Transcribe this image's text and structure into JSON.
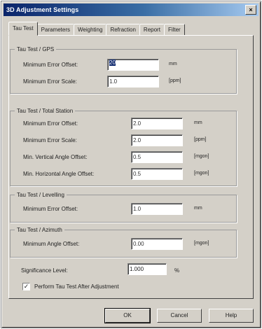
{
  "window": {
    "title": "3D Adjustment Settings",
    "close_glyph": "×"
  },
  "tabs": [
    {
      "label": "Tau Test",
      "active": true
    },
    {
      "label": "Parameters"
    },
    {
      "label": "Weighting"
    },
    {
      "label": "Refraction"
    },
    {
      "label": "Report"
    },
    {
      "label": "Filter"
    }
  ],
  "gps": {
    "title": "Tau Test / GPS",
    "min_error_offset": {
      "label": "Minimum Error Offset:",
      "value": "20",
      "unit": "mm"
    },
    "min_error_scale": {
      "label": "Minimum Error Scale:",
      "value": "1.0",
      "unit": "[ppm]"
    }
  },
  "total_station": {
    "title": "Tau Test / Total Station",
    "min_error_offset": {
      "label": "Minimum Error Offset:",
      "value": "2.0",
      "unit": "mm"
    },
    "min_error_scale": {
      "label": "Minimum Error Scale:",
      "value": "2.0",
      "unit": "[ppm]"
    },
    "min_vertical_angle_offset": {
      "label": "Min. Vertical Angle Offset:",
      "value": "0.5",
      "unit": "[mgon]"
    },
    "min_horizontal_angle_offset": {
      "label": "Min. Horizontal Angle Offset:",
      "value": "0.5",
      "unit": "[mgon]"
    }
  },
  "levelling": {
    "title": "Tau Test / Levelling",
    "min_error_offset": {
      "label": "Minimum Error Offset:",
      "value": "1.0",
      "unit": "mm"
    }
  },
  "azimuth": {
    "title": "Tau Test / Azimuth",
    "min_angle_offset": {
      "label": "Minimum Angle Offset:",
      "value": "0.00",
      "unit": "[mgon]"
    }
  },
  "significance": {
    "label": "Significance Level:",
    "value": "1.000",
    "unit": "%"
  },
  "checkbox": {
    "label": "Perform Tau Test After Adjustment",
    "checked": true,
    "mark": "✓"
  },
  "buttons": {
    "ok": "OK",
    "cancel": "Cancel",
    "help": "Help"
  }
}
